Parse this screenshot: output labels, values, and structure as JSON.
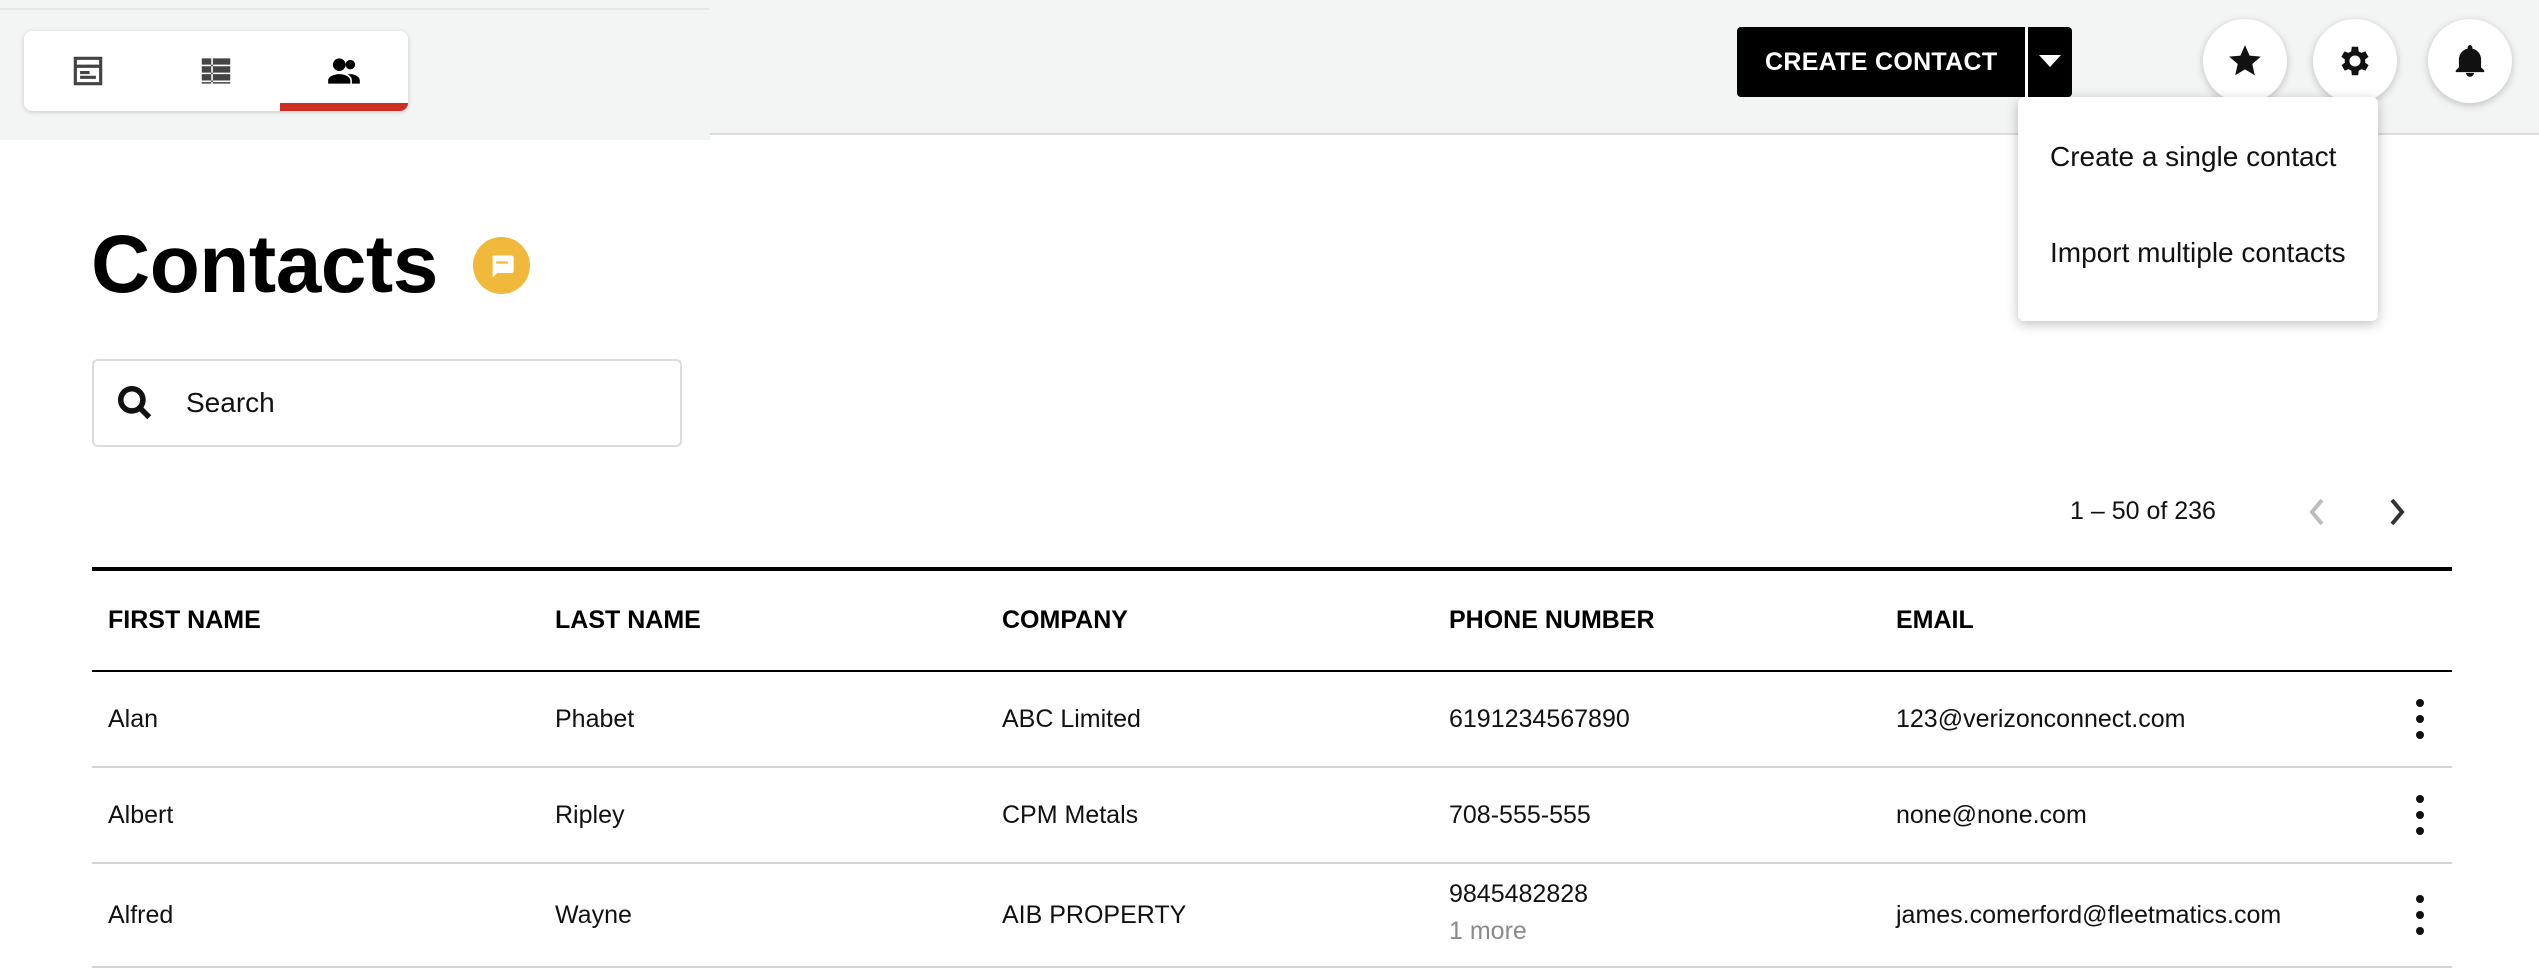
{
  "nav": {
    "tabs": [
      {
        "icon": "dashboard-icon",
        "active": false
      },
      {
        "icon": "table-list-icon",
        "active": false
      },
      {
        "icon": "contacts-icon",
        "active": true
      }
    ]
  },
  "header": {
    "create_label": "CREATE CONTACT",
    "create_menu": [
      "Create a single contact",
      "Import multiple contacts"
    ],
    "icons": [
      "star-icon",
      "gear-icon",
      "bell-icon"
    ]
  },
  "page": {
    "title": "Contacts"
  },
  "search": {
    "placeholder": "Search"
  },
  "pagination": {
    "label": "1 – 50 of 236"
  },
  "table": {
    "columns": [
      "FIRST NAME",
      "LAST NAME",
      "COMPANY",
      "PHONE NUMBER",
      "EMAIL"
    ],
    "rows": [
      {
        "first": "Alan",
        "last": "Phabet",
        "company": "ABC Limited",
        "phone": "6191234567890",
        "phone_more": "",
        "email": "123@verizonconnect.com"
      },
      {
        "first": "Albert",
        "last": "Ripley",
        "company": "CPM Metals",
        "phone": "708-555-555",
        "phone_more": "",
        "email": "none@none.com"
      },
      {
        "first": "Alfred",
        "last": "Wayne",
        "company": "AIB PROPERTY",
        "phone": "9845482828",
        "phone_more": "1 more",
        "email": "james.comerford@fleetmatics.com"
      }
    ]
  },
  "colors": {
    "accent": "#cc2f24",
    "chat_badge": "#f0b93c"
  }
}
